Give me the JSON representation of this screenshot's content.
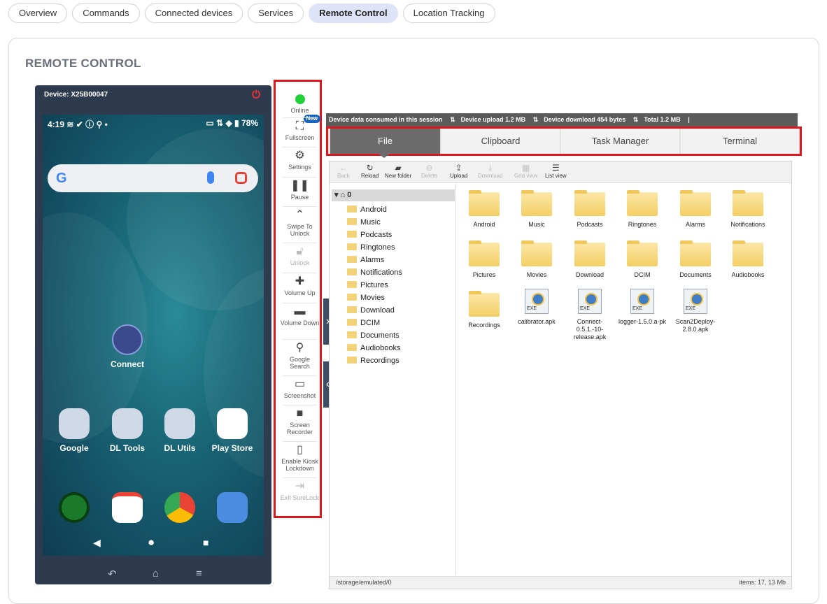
{
  "tabs": [
    "Overview",
    "Commands",
    "Connected devices",
    "Services",
    "Remote Control",
    "Location Tracking"
  ],
  "active_tab": "Remote Control",
  "card_title": "REMOTE CONTROL",
  "device": {
    "id_label": "Device: X25B00047",
    "status_time": "4:19",
    "battery": "78%",
    "search_logo": "G",
    "apps": {
      "connect": "Connect",
      "google": "Google",
      "dl_tools": "DL Tools",
      "dl_utils": "DL Utils",
      "play_store": "Play Store"
    }
  },
  "controls": {
    "online": "Online",
    "new_badge": "New",
    "fullscreen": "Fullscreen",
    "settings": "Settings",
    "pause": "Pause",
    "swipe_unlock": "Swipe To Unlock",
    "unlock": "Unlock",
    "volume_up": "Volume Up",
    "volume_down": "Volume Down",
    "google_search": "Google Search",
    "screenshot": "Screenshot",
    "screen_recorder": "Screen Recorder",
    "kiosk": "Enable Kiosk Lockdown",
    "exit_surelock": "Exit SureLock"
  },
  "data_usage": {
    "label": "Device data consumed in this session",
    "upload": "Device upload 1.2 MB",
    "download": "Device download 454 bytes",
    "total": "Total 1.2 MB"
  },
  "file_tabs": [
    "File",
    "Clipboard",
    "Task Manager",
    "Terminal"
  ],
  "toolbar": {
    "back": "Back",
    "reload": "Reload",
    "new_folder": "New folder",
    "delete": "Delete",
    "upload": "Upload",
    "download": "Download",
    "grid_view": "Grid view",
    "list_view": "List view"
  },
  "tree": {
    "root": "0",
    "items": [
      "Android",
      "Music",
      "Podcasts",
      "Ringtones",
      "Alarms",
      "Notifications",
      "Pictures",
      "Movies",
      "Download",
      "DCIM",
      "Documents",
      "Audiobooks",
      "Recordings"
    ]
  },
  "grid_folders": [
    "Android",
    "Music",
    "Podcasts",
    "Ringtones",
    "Alarms",
    "Notifications",
    "Pictures",
    "Movies",
    "Download",
    "DCIM",
    "Documents",
    "Audiobooks",
    "Recordings"
  ],
  "grid_files": [
    "calibrator.apk",
    "Connect-0.5.1.-10-release.apk",
    "logger-1.5.0.a-pk",
    "Scan2Deploy-2.8.0.apk"
  ],
  "status": {
    "path": "/storage/emulated/0",
    "items": "items: 17, 13 Mb"
  }
}
